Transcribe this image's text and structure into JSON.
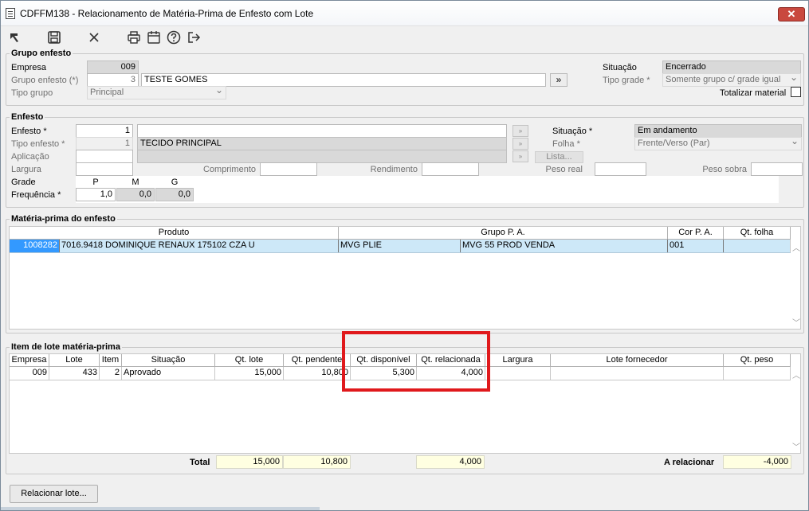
{
  "window": {
    "title": "CDFFM138 - Relacionamento de Matéria-Prima de Enfesto com Lote",
    "close_label": "✕"
  },
  "toolbar": {
    "icons": [
      "select-icon",
      "save-icon",
      "cancel-icon",
      "print-icon",
      "calendar-icon",
      "help-icon",
      "exit-icon"
    ]
  },
  "grupo": {
    "legend": "Grupo enfesto",
    "empresa_label": "Empresa",
    "empresa_value": "009",
    "grupo_label": "Grupo enfesto (*)",
    "grupo_code": "3",
    "grupo_name": "TESTE GOMES",
    "grupo_button": "»",
    "tipo_label": "Tipo grupo",
    "tipo_value": "Principal",
    "situacao_label": "Situação",
    "situacao_value": "Encerrado",
    "tipo_grade_label": "Tipo grade *",
    "tipo_grade_value": "Somente grupo c/ grade igual",
    "totalizar_label": "Totalizar material"
  },
  "enfesto": {
    "legend": "Enfesto",
    "enfesto_label": "Enfesto *",
    "enfesto_value": "1",
    "tipo_label": "Tipo enfesto *",
    "tipo_code": "1",
    "tipo_name": "TECIDO PRINCIPAL",
    "aplicacao_label": "Aplicação",
    "largura_label": "Largura",
    "comprimento_label": "Comprimento",
    "rendimento_label": "Rendimento",
    "peso_real_label": "Peso real",
    "peso_sobra_label": "Peso sobra",
    "situacao_label": "Situação *",
    "situacao_value": "Em andamento",
    "folha_label": "Folha *",
    "folha_value": "Frente/Verso (Par)",
    "lista_label": "Lista...",
    "grade_label": "Grade",
    "frequencia_label": "Frequência *",
    "sizes": [
      "P",
      "M",
      "G"
    ],
    "freq_values": [
      "1,0",
      "0,0",
      "0,0"
    ]
  },
  "materia": {
    "legend": "Matéria-prima do enfesto",
    "headers": [
      "Produto",
      "Grupo P. A.",
      "Cor P. A.",
      "Qt. folha"
    ],
    "row": {
      "codigo": "1008282",
      "descricao": "7016.9418 DOMINIQUE RENAUX 175102 CZA U",
      "grupo1": "MVG PLIE",
      "grupo2": "MVG 55 PROD VENDA",
      "cor": "001",
      "qt_folha": ""
    }
  },
  "lote": {
    "legend": "Item de lote matéria-prima",
    "headers": [
      "Empresa",
      "Lote",
      "Item",
      "Situação",
      "Qt. lote",
      "Qt. pendente",
      "Qt. disponível",
      "Qt. relacionada",
      "Largura",
      "Lote fornecedor",
      "Qt. peso"
    ],
    "row": {
      "empresa": "009",
      "lote": "433",
      "item": "2",
      "situacao": "Aprovado",
      "qt_lote": "15,000",
      "qt_pendente": "10,800",
      "qt_disponivel": "5,300",
      "qt_relacionada": "4,000",
      "largura": "",
      "lote_fornecedor": "",
      "qt_peso": ""
    },
    "total_label": "Total",
    "total_qt_lote": "15,000",
    "total_qt_pendente": "10,800",
    "total_qt_relacionada": "4,000",
    "a_relacionar_label": "A relacionar",
    "a_relacionar_value": "-4,000"
  },
  "footer": {
    "relacionar_label": "Relacionar lote..."
  },
  "colors": {
    "highlight": "#e0191c",
    "selection": "#cde8f8",
    "total_bg": "#ffffe1"
  }
}
